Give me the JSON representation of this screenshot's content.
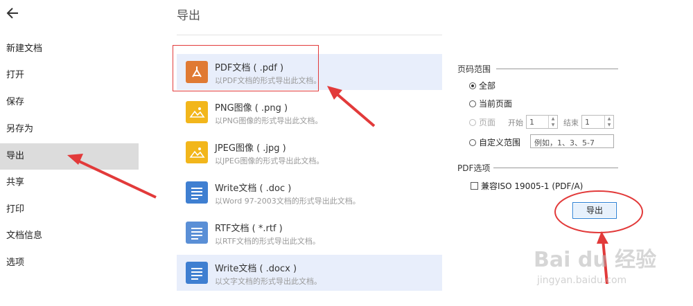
{
  "sidebar": {
    "items": [
      {
        "label": "新建文档",
        "active": false
      },
      {
        "label": "打开",
        "active": false
      },
      {
        "label": "保存",
        "active": false
      },
      {
        "label": "另存为",
        "active": false
      },
      {
        "label": "导出",
        "active": true
      },
      {
        "label": "共享",
        "active": false
      },
      {
        "label": "打印",
        "active": false
      },
      {
        "label": "文档信息",
        "active": false
      },
      {
        "label": "选项",
        "active": false
      }
    ]
  },
  "main": {
    "title": "导出",
    "formats": [
      {
        "name": "PDF文档 ( .pdf )",
        "desc": "以PDF文档的形式导出此文档。",
        "icon": "pdf-icon",
        "selected": true
      },
      {
        "name": "PNG图像 ( .png )",
        "desc": "以PNG图像的形式导出此文档。",
        "icon": "image-icon",
        "selected": false
      },
      {
        "name": "JPEG图像 ( .jpg )",
        "desc": "以JPEG图像的形式导出此文档。",
        "icon": "image-icon",
        "selected": false
      },
      {
        "name": "Write文档 ( .doc )",
        "desc": "以Word 97-2003文档的形式导出此文档。",
        "icon": "document-icon",
        "selected": false
      },
      {
        "name": "RTF文档 ( *.rtf )",
        "desc": "以RTF文档的形式导出此文档。",
        "icon": "document-icon",
        "selected": false
      },
      {
        "name": "Write文档 ( .docx )",
        "desc": "以文字文档的形式导出此文档。",
        "icon": "document-icon",
        "selected": true
      }
    ]
  },
  "options": {
    "page_range_label": "页码范围",
    "all": "全部",
    "current_page": "当前页面",
    "pages": "页面",
    "start_label": "开始",
    "start_value": "1",
    "end_label": "结束",
    "end_value": "1",
    "custom_range": "自定义范围",
    "custom_placeholder": "例如，1、3、5-7",
    "pdf_options_label": "PDF选项",
    "pdfa_checkbox": "兼容ISO 19005-1 (PDF/A)",
    "export_button": "导出"
  },
  "watermark": {
    "brand": "Bai du 经验",
    "url": "jingyan.baidu.com"
  },
  "colors": {
    "pdf_icon": "#e07a33",
    "image_icon": "#f2b61b",
    "doc_icon": "#3f7fd1",
    "annotation": "#e23a3a",
    "selected_row": "#e8eefb",
    "active_sidebar": "#dcdcdc"
  }
}
